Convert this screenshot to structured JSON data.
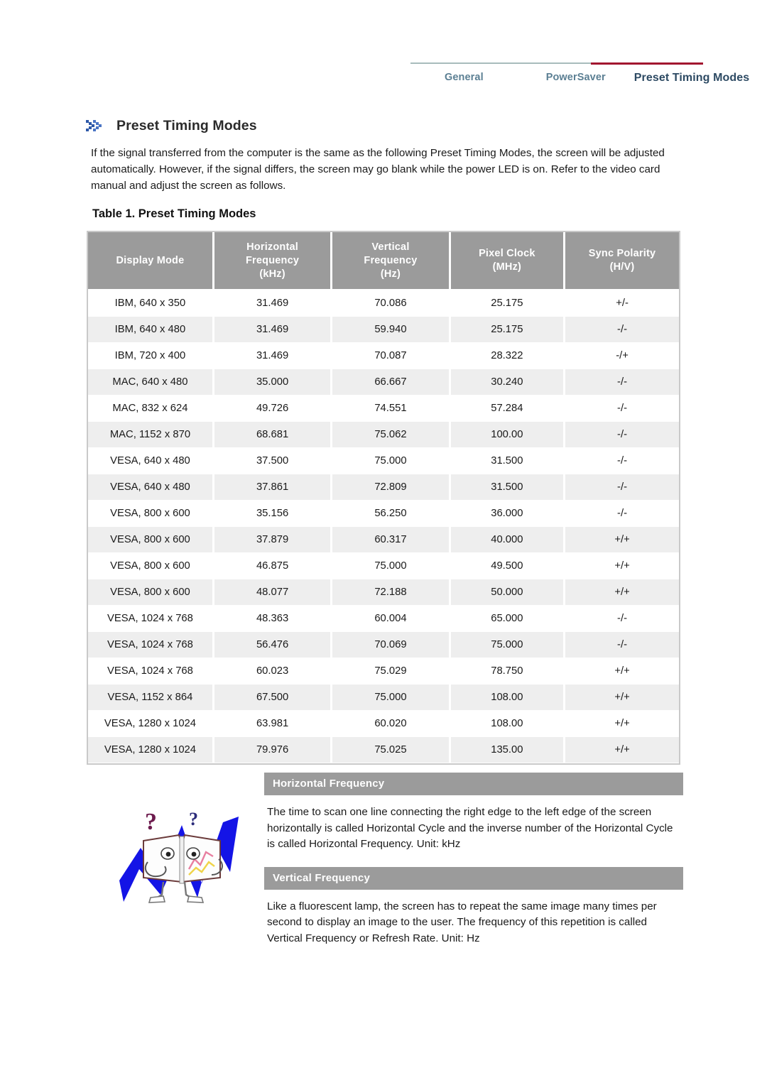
{
  "nav": {
    "tabs": [
      {
        "label": "General",
        "active": false
      },
      {
        "label": "PowerSaver",
        "active": false
      },
      {
        "label": "Preset Timing Modes",
        "active": true
      }
    ],
    "accent_active": "#a2132f",
    "accent_rule": "#a8bcbc"
  },
  "page": {
    "title": "Preset Timing Modes",
    "icon": "double-chevron-icon",
    "intro": "If the signal transferred from the computer is the same as the following Preset Timing Modes, the screen will be adjusted automatically. However, if the signal differs, the screen may go blank while the power LED is on. Refer to the video card manual and adjust the screen as follows."
  },
  "table": {
    "caption": "Table 1. Preset Timing Modes",
    "header_bg": "#9b9b9b",
    "stripe_bg": "#eeeeee",
    "columns": [
      "Display Mode",
      "Horizontal\nFrequency\n(kHz)",
      "Vertical\nFrequency\n(Hz)",
      "Pixel Clock\n(MHz)",
      "Sync Polarity\n(H/V)"
    ],
    "columns_lines": [
      [
        "Display Mode"
      ],
      [
        "Horizontal",
        "Frequency",
        "(kHz)"
      ],
      [
        "Vertical",
        "Frequency",
        "(Hz)"
      ],
      [
        "Pixel Clock",
        "(MHz)"
      ],
      [
        "Sync Polarity",
        "(H/V)"
      ]
    ],
    "rows": [
      [
        "IBM, 640 x 350",
        "31.469",
        "70.086",
        "25.175",
        "+/-"
      ],
      [
        "IBM, 640 x 480",
        "31.469",
        "59.940",
        "25.175",
        "-/-"
      ],
      [
        "IBM, 720 x 400",
        "31.469",
        "70.087",
        "28.322",
        "-/+"
      ],
      [
        "MAC, 640 x 480",
        "35.000",
        "66.667",
        "30.240",
        "-/-"
      ],
      [
        "MAC, 832 x 624",
        "49.726",
        "74.551",
        "57.284",
        "-/-"
      ],
      [
        "MAC, 1152 x 870",
        "68.681",
        "75.062",
        "100.00",
        "-/-"
      ],
      [
        "VESA, 640 x 480",
        "37.500",
        "75.000",
        "31.500",
        "-/-"
      ],
      [
        "VESA, 640 x 480",
        "37.861",
        "72.809",
        "31.500",
        "-/-"
      ],
      [
        "VESA, 800 x 600",
        "35.156",
        "56.250",
        "36.000",
        "-/-"
      ],
      [
        "VESA, 800 x 600",
        "37.879",
        "60.317",
        "40.000",
        "+/+"
      ],
      [
        "VESA, 800 x 600",
        "46.875",
        "75.000",
        "49.500",
        "+/+"
      ],
      [
        "VESA, 800 x 600",
        "48.077",
        "72.188",
        "50.000",
        "+/+"
      ],
      [
        "VESA, 1024 x 768",
        "48.363",
        "60.004",
        "65.000",
        "-/-"
      ],
      [
        "VESA, 1024 x 768",
        "56.476",
        "70.069",
        "75.000",
        "-/-"
      ],
      [
        "VESA, 1024 x 768",
        "60.023",
        "75.029",
        "78.750",
        "+/+"
      ],
      [
        "VESA, 1152 x 864",
        "67.500",
        "75.000",
        "108.00",
        "+/+"
      ],
      [
        "VESA, 1280 x 1024",
        "63.981",
        "60.020",
        "108.00",
        "+/+"
      ],
      [
        "VESA, 1280 x 1024",
        "79.976",
        "75.025",
        "135.00",
        "+/+"
      ]
    ]
  },
  "info_sections": [
    {
      "heading": "Horizontal Frequency",
      "body": "The time to scan one line connecting the right edge to the left edge of the screen horizontally is called Horizontal Cycle and the inverse number of the Horizontal Cycle is called Horizontal Frequency. Unit: kHz"
    },
    {
      "heading": "Vertical Frequency",
      "body": "Like a fluorescent lamp, the screen has to repeat the same image many times per second to display an image to the user. The frequency of this repetition is called Vertical Frequency or Refresh Rate. Unit: Hz"
    }
  ],
  "illustration": {
    "name": "open-book-with-question-marks-illustration"
  }
}
